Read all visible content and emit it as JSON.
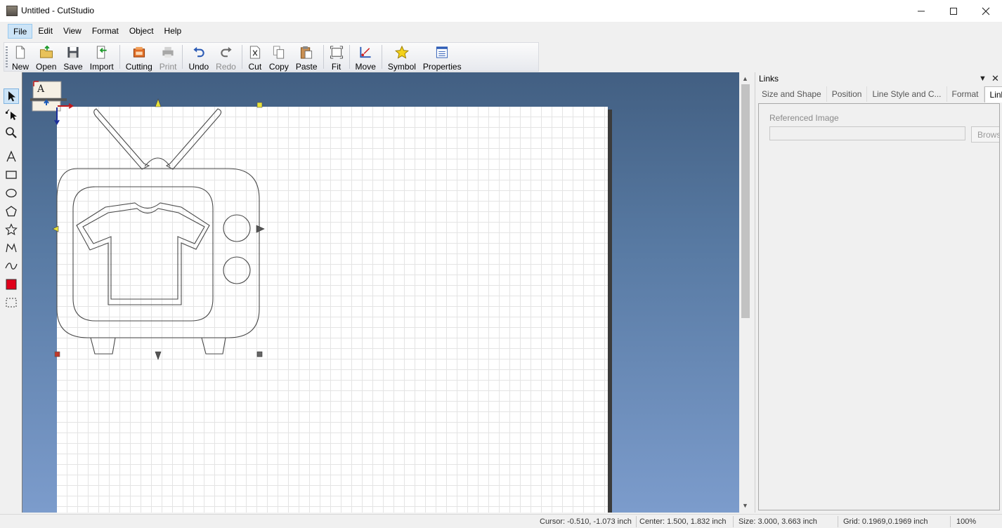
{
  "window": {
    "title": "Untitled - CutStudio",
    "minimize_icon": "minimize-icon",
    "maximize_icon": "maximize-icon",
    "close_icon": "close-icon"
  },
  "menu": [
    "File",
    "Edit",
    "View",
    "Format",
    "Object",
    "Help"
  ],
  "toolbar": {
    "new": "New",
    "open": "Open",
    "save": "Save",
    "import": "Import",
    "cutting": "Cutting",
    "print": "Print",
    "undo": "Undo",
    "redo": "Redo",
    "cut": "Cut",
    "copy": "Copy",
    "paste": "Paste",
    "fit": "Fit",
    "move": "Move",
    "symbol": "Symbol",
    "properties": "Properties"
  },
  "canvas": {
    "text_marker": "A"
  },
  "panel": {
    "title": "Links",
    "tabs": [
      "Size and Shape",
      "Position",
      "Line Style and C...",
      "Format",
      "Links"
    ],
    "active_tab": "Links",
    "referenced_image_label": "Referenced Image",
    "referenced_image_value": "",
    "browse_label": "Browse"
  },
  "status": {
    "cursor": "Cursor: -0.510, -1.073 inch",
    "center": "Center: 1.500, 1.832 inch",
    "size": "Size: 3.000, 3.663 inch",
    "grid": "Grid: 0.1969,0.1969 inch",
    "zoom": "100%"
  },
  "colors": {
    "fill_swatch": "#e0001a",
    "workspace_top": "#425f82",
    "workspace_bottom": "#7c9ccc"
  }
}
